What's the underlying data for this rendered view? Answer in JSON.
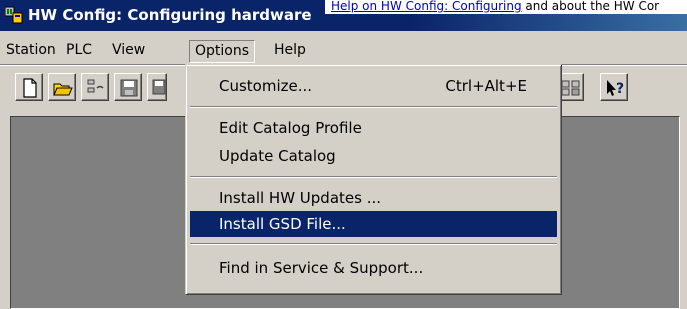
{
  "window": {
    "title": "HW Config: Configuring hardware",
    "overlay_link": "Help on HW Config: Configuring",
    "overlay_tail": " and about the HW Cor"
  },
  "menubar": {
    "items": [
      "Station",
      "PLC",
      "View",
      "Options",
      "Help"
    ],
    "active": "Options"
  },
  "options_menu": {
    "customize": {
      "label": "Customize...",
      "shortcut": "Ctrl+Alt+E"
    },
    "edit_catalog_profile": "Edit Catalog Profile",
    "update_catalog": "Update Catalog",
    "install_hw_updates": "Install HW Updates ...",
    "install_gsd_file": "Install GSD File...",
    "find_in_service_support": "Find in Service & Support..."
  },
  "toolbar": {
    "icons": [
      "new-icon",
      "open-icon",
      "network-icon",
      "save-icon",
      "save-compile-icon",
      "module-info-icon",
      "context-help-icon"
    ]
  },
  "colors": {
    "titlebar": "#0a246a",
    "highlight": "#0a246a",
    "face": "#d4d0c8",
    "workarea": "#808080"
  }
}
